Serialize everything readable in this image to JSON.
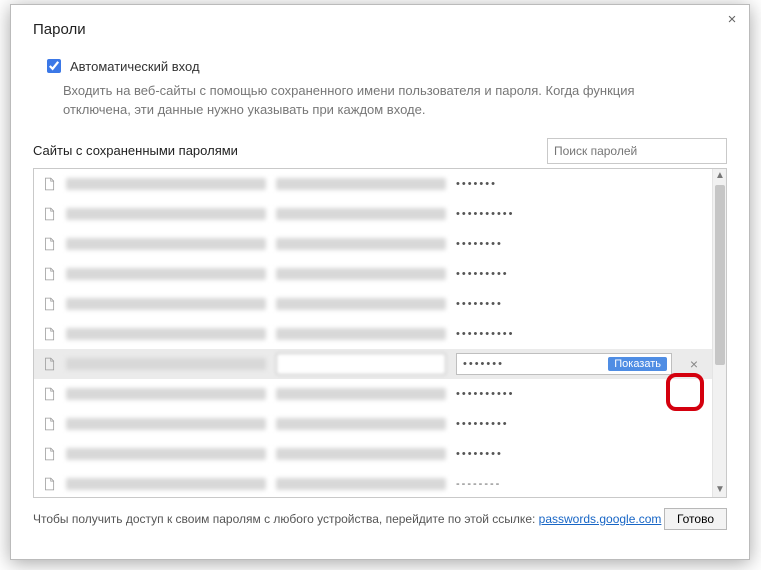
{
  "dialog": {
    "title": "Пароли",
    "close_glyph": "×"
  },
  "auto_signin": {
    "checked": true,
    "label": "Автоматический вход",
    "description": "Входить на веб-сайты с помощью сохраненного имени пользователя и пароля. Когда функция отключена, эти данные нужно указывать при каждом входе."
  },
  "saved": {
    "section_title": "Сайты с сохраненными паролями",
    "search_placeholder": "Поиск паролей"
  },
  "rows": [
    {
      "pwd": "•••••••"
    },
    {
      "pwd": "••••••••••"
    },
    {
      "pwd": "••••••••"
    },
    {
      "pwd": "•••••••••"
    },
    {
      "pwd": "••••••••"
    },
    {
      "pwd": "••••••••••"
    },
    {
      "pwd": "•••••••",
      "selected": true,
      "show_label": "Показать",
      "del_glyph": "×"
    },
    {
      "pwd": "••••••••••"
    },
    {
      "pwd": "•••••••••"
    },
    {
      "pwd": "••••••••"
    },
    {
      "pwd": "--------"
    }
  ],
  "footer": {
    "text": "Чтобы получить доступ к своим паролям с любого устройства, перейдите по этой ссылке: ",
    "link_text": "passwords.google.com",
    "done_label": "Готово"
  },
  "scrollbar": {
    "up": "▲",
    "down": "▼"
  }
}
